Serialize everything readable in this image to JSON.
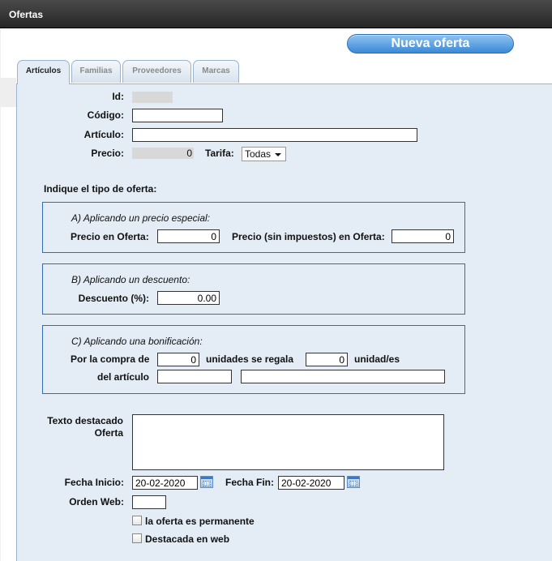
{
  "window": {
    "title": "Ofertas"
  },
  "header": {
    "new_button": "Nueva oferta"
  },
  "tabs": [
    {
      "label": "Artículos",
      "active": true
    },
    {
      "label": "Familias",
      "active": false
    },
    {
      "label": "Proveedores",
      "active": false
    },
    {
      "label": "Marcas",
      "active": false
    }
  ],
  "form": {
    "id_label": "Id:",
    "codigo_label": "Código:",
    "codigo_value": "",
    "articulo_label": "Artículo:",
    "articulo_value": "",
    "precio_label": "Precio:",
    "precio_value": "0",
    "tarifa_label": "Tarifa:",
    "tarifa_value": "Todas",
    "tipo_heading": "Indique el tipo de oferta:"
  },
  "section_a": {
    "title": "A) Aplicando un precio especial:",
    "precio_oferta_label": "Precio en Oferta:",
    "precio_oferta_value": "0",
    "precio_sin_imp_label": "Precio (sin impuestos) en Oferta:",
    "precio_sin_imp_value": "0"
  },
  "section_b": {
    "title": "B) Aplicando un descuento:",
    "descuento_label": "Descuento (%):",
    "descuento_value": "0.00"
  },
  "section_c": {
    "title": "C) Aplicando una bonificación:",
    "por_compra_label": "Por la compra de",
    "compra_value": "0",
    "unidades_regala_label": "unidades se regala",
    "regala_value": "0",
    "unidades_label": "unidad/es",
    "del_articulo_label": "del artículo",
    "articulo_code_value": "",
    "articulo_name_value": ""
  },
  "bottom": {
    "texto_label_1": "Texto destacado",
    "texto_label_2": "Oferta",
    "texto_value": "",
    "fecha_inicio_label": "Fecha Inicio:",
    "fecha_inicio_value": "20-02-2020",
    "fecha_fin_label": "Fecha Fin:",
    "fecha_fin_value": "20-02-2020",
    "orden_web_label": "Orden Web:",
    "orden_web_value": "",
    "permanente_label": "la oferta es permanente",
    "permanente_checked": false,
    "destacada_label": "Destacada en web",
    "destacada_checked": false
  },
  "colors": {
    "panel_bg": "#e4ecf5",
    "section_border": "#2f6db7",
    "button_blue": "#3b89d6"
  },
  "icons": {
    "calendar": "calendar-icon",
    "dropdown": "chevron-down-icon"
  }
}
